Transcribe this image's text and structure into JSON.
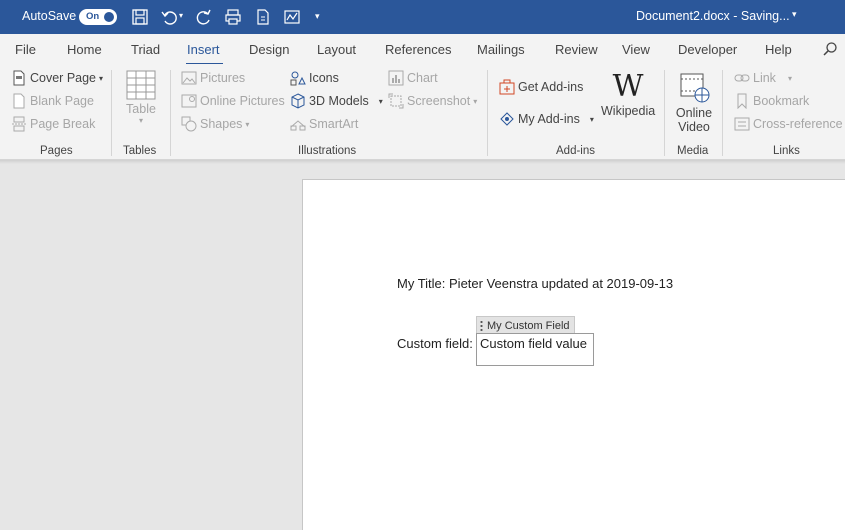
{
  "titlebar": {
    "autosave_label": "AutoSave",
    "toggle_state": "On",
    "doc_title": "Document2.docx  -  Saving...",
    "bg_color": "#2b579a"
  },
  "tabs": [
    "File",
    "Home",
    "Triad",
    "Insert",
    "Design",
    "Layout",
    "References",
    "Mailings",
    "Review",
    "View",
    "Developer",
    "Help"
  ],
  "active_tab": "Insert",
  "ribbon": {
    "pages": {
      "label": "Pages",
      "cover_page": "Cover Page",
      "blank_page": "Blank Page",
      "page_break": "Page Break"
    },
    "tables": {
      "label": "Tables",
      "table": "Table"
    },
    "illustrations": {
      "label": "Illustrations",
      "pictures": "Pictures",
      "online_pictures": "Online Pictures",
      "shapes": "Shapes",
      "icons": "Icons",
      "models_3d": "3D Models",
      "smartart": "SmartArt",
      "chart": "Chart",
      "screenshot": "Screenshot"
    },
    "addins": {
      "label": "Add-ins",
      "get_addins": "Get Add-ins",
      "my_addins": "My Add-ins",
      "wikipedia": "Wikipedia"
    },
    "media": {
      "label": "Media",
      "online_video_line1": "Online",
      "online_video_line2": "Video"
    },
    "links": {
      "label": "Links",
      "link": "Link",
      "bookmark": "Bookmark",
      "cross_reference": "Cross-reference"
    }
  },
  "document": {
    "title_line": "My Title: Pieter Veenstra updated at 2019-09-13",
    "custom_field_label": "Custom field:",
    "content_control_tag": "My Custom Field",
    "custom_field_value": "Custom field value"
  }
}
